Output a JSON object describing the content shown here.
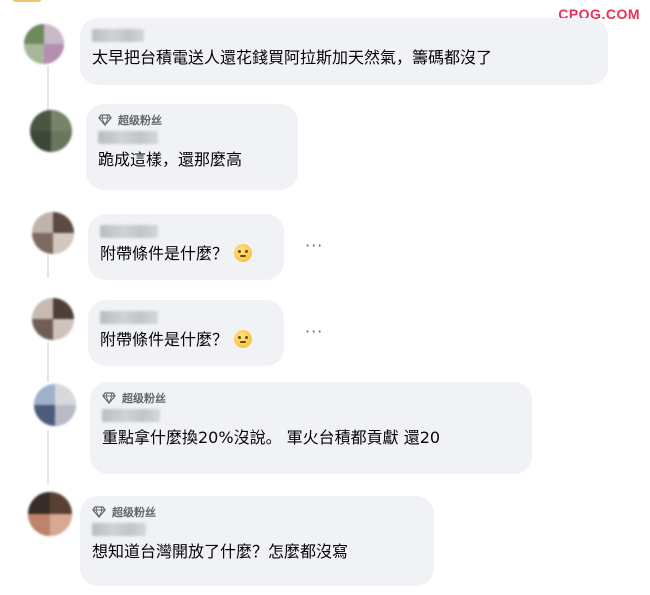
{
  "watermark": "CPQG.COM",
  "badge_label": "超级粉丝",
  "more_label": "···",
  "comments": [
    {
      "text": "太早把台積電送人還花錢買阿拉斯加天然氣，籌碼都沒了"
    },
    {
      "text": "跪成這樣，還那麼高"
    },
    {
      "text": "附帶條件是什麼？"
    },
    {
      "text": "附帶條件是什麼？"
    },
    {
      "text": "重點拿什麼換20%沒說。 軍火台積都貢獻 還20"
    },
    {
      "text": "想知道台灣開放了什麼？怎麼都沒寫"
    }
  ]
}
